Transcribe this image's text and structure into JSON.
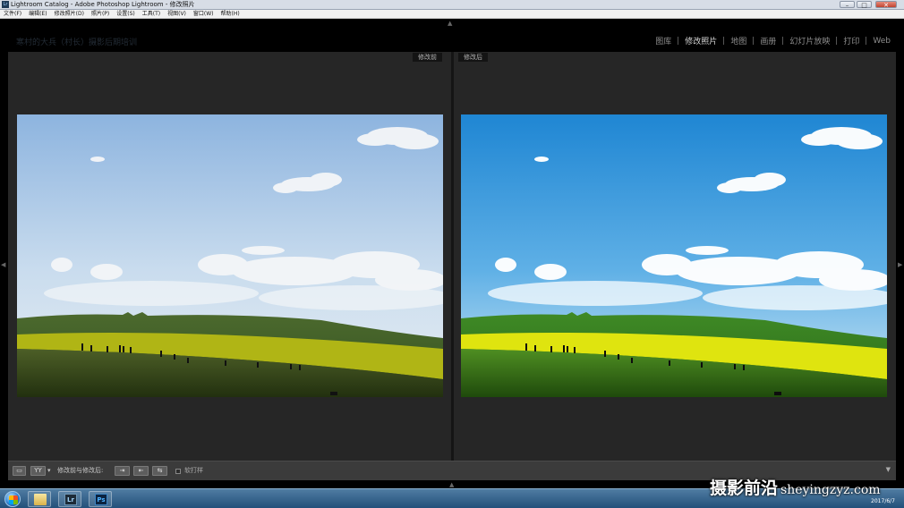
{
  "window": {
    "title": "Lightroom Catalog - Adobe Photoshop Lightroom - 修改照片",
    "app_icon": "Lr"
  },
  "menubar": {
    "items": [
      "文件(F)",
      "编辑(E)",
      "修改照片(D)",
      "照片(P)",
      "设置(S)",
      "工具(T)",
      "视图(V)",
      "窗口(W)",
      "帮助(H)"
    ]
  },
  "identity_plate": "寒村的大兵（村长）摄影后期培训",
  "modules": {
    "items": [
      "图库",
      "修改照片",
      "地图",
      "画册",
      "幻灯片放映",
      "打印",
      "Web"
    ],
    "active": "修改照片"
  },
  "compare": {
    "before_label": "修改前",
    "after_label": "修改后"
  },
  "toolbar": {
    "view_mode_label": "YY",
    "before_after_label": "修改前与修改后:",
    "soft_proof_label": "软打样"
  },
  "taskbar": {
    "date": "2017/6/7",
    "apps": [
      "explorer",
      "Lr",
      "Ps"
    ]
  },
  "watermark": {
    "cn": "摄影前沿",
    "url": "sheyingzyz.com"
  },
  "colors": {
    "panel_bg": "#262626",
    "toolbar_bg": "#3b3b3b",
    "before_sky": "#bcd4ea",
    "after_sky": "#2f8fd8",
    "after_field": "#d8de16"
  }
}
